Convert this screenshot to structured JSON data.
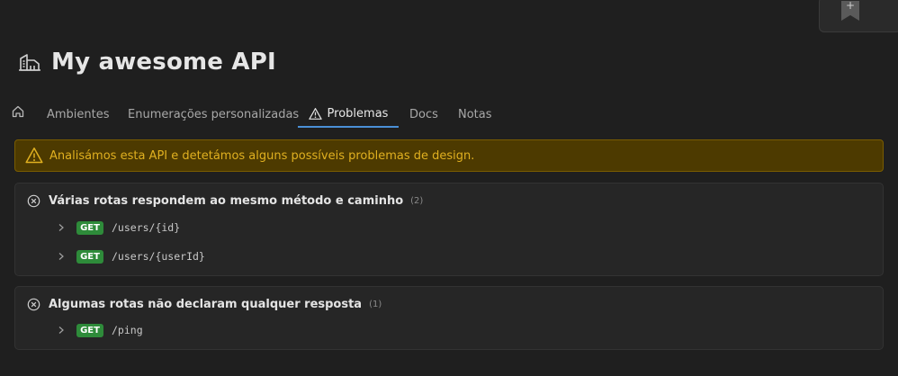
{
  "corner": {
    "bookmark_plus": "+"
  },
  "header": {
    "title": "My awesome API"
  },
  "tabs": {
    "ambientes": "Ambientes",
    "enumeracoes": "Enumerações personalizadas",
    "problemas": "Problemas",
    "docs": "Docs",
    "notas": "Notas"
  },
  "alert": {
    "text": "Analisámos esta API e detetámos alguns possíveis problemas de design."
  },
  "problems": [
    {
      "title": "Várias rotas respondem ao mesmo método e caminho",
      "count": "(2)",
      "routes": [
        {
          "method": "GET",
          "path": "/users/{id}"
        },
        {
          "method": "GET",
          "path": "/users/{userId}"
        }
      ]
    },
    {
      "title": "Algumas rotas não declaram qualquer resposta",
      "count": "(1)",
      "routes": [
        {
          "method": "GET",
          "path": "/ping"
        }
      ]
    }
  ],
  "colors": {
    "background": "#1f1f1f",
    "warning_bg": "#4d3a00",
    "warning_text": "#e0b020",
    "get_badge": "#2e8b3a",
    "active_tab_underline": "#4a8fd6"
  },
  "icons": {
    "api": "api-building-icon",
    "home": "home-icon",
    "warning": "warning-triangle-icon",
    "error": "circle-x-icon",
    "expand": "chevron-right-icon",
    "bookmark": "bookmark-add-icon"
  }
}
